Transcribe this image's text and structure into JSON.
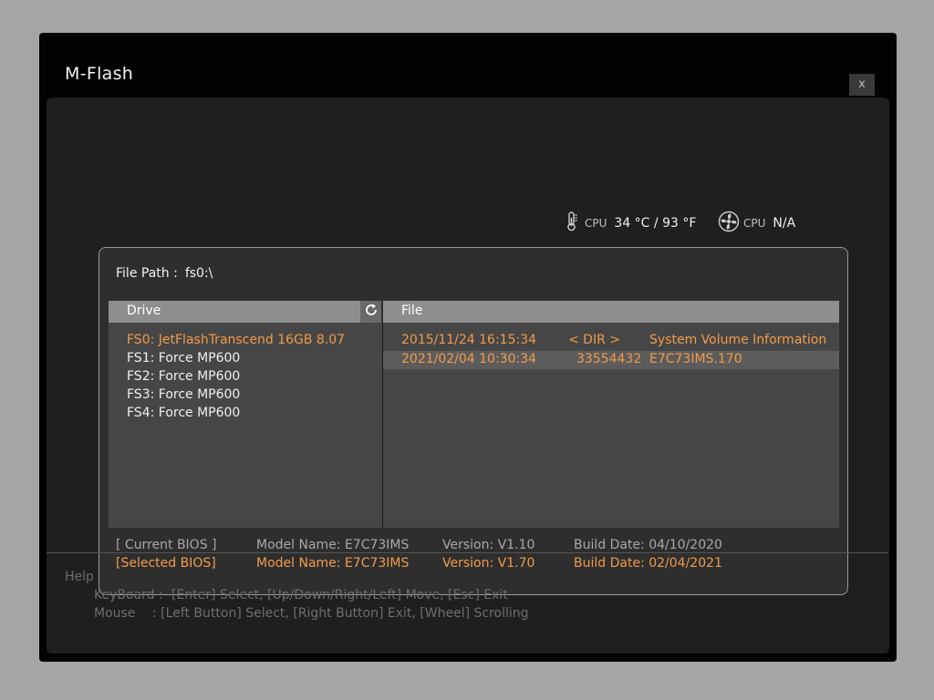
{
  "window": {
    "title": "M-Flash",
    "close_label": "x"
  },
  "status": {
    "temp": {
      "label": "CPU",
      "value": "34 °C / 93 °F",
      "icon": "thermometer-icon"
    },
    "fan": {
      "label": "CPU",
      "value": "N/A",
      "icon": "fan-icon"
    }
  },
  "file_path": {
    "label": "File Path :",
    "value": "fs0:\\"
  },
  "drive_panel": {
    "header": "Drive",
    "refresh_icon": "refresh-icon",
    "items": [
      {
        "label": "FS0: JetFlashTranscend 16GB 8.07",
        "selected": true
      },
      {
        "label": "FS1: Force MP600",
        "selected": false
      },
      {
        "label": "FS2: Force MP600",
        "selected": false
      },
      {
        "label": "FS3: Force MP600",
        "selected": false
      },
      {
        "label": "FS4: Force MP600",
        "selected": false
      }
    ]
  },
  "file_panel": {
    "header": "File",
    "rows": [
      {
        "date": "2015/11/24 16:15:34",
        "size": "< DIR >",
        "name": "System Volume Information",
        "highlighted": false
      },
      {
        "date": "2021/02/04 10:30:34",
        "size": "33554432",
        "name": "E7C73IMS.170",
        "highlighted": true
      }
    ]
  },
  "bios_info": {
    "current": {
      "label": "[ Current BIOS  ]",
      "model": "Model Name: E7C73IMS",
      "version": "Version: V1.10",
      "build": "Build Date: 04/10/2020"
    },
    "selected": {
      "label": "[Selected BIOS]",
      "model": "Model Name: E7C73IMS",
      "version": "Version: V1.70",
      "build": "Build Date: 02/04/2021"
    }
  },
  "help": {
    "title": "Help",
    "keyboard_label": "KeyBoard :",
    "keyboard_text": "[Enter]  Select,   [Up/Down/Right/Left]  Move,   [Esc]  Exit",
    "mouse_label": "Mouse",
    "mouse_text": ":   [Left Button]  Select,   [Right Button]  Exit,   [Wheel]  Scrolling"
  },
  "colors": {
    "accent": "#f29a4a",
    "background": "#1f1f1f",
    "window": "#020202",
    "panel": "#2e2e2e",
    "list": "#464646",
    "header": "#8e8e8e"
  }
}
